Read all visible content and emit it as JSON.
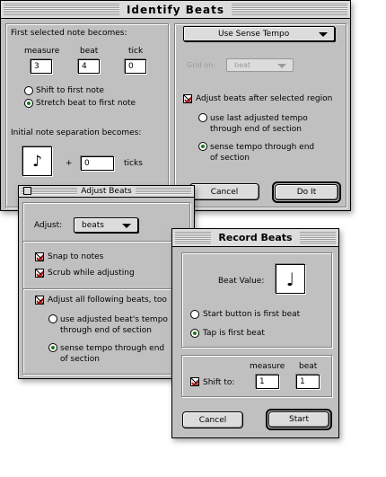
{
  "identify": {
    "title": "Identify Beats",
    "first_note_label": "First selected note becomes:",
    "col_measure": "measure",
    "col_beat": "beat",
    "col_tick": "tick",
    "measure_value": "3",
    "beat_value": "4",
    "tick_value": "0",
    "radio_shift": "Shift to first note",
    "radio_stretch": "Stretch beat to first note",
    "separation_label": "Initial note separation becomes:",
    "note_glyph": "♪",
    "plus": "+",
    "ticks_value": "0",
    "ticks_label": "ticks",
    "mode_popup": "Use Sense Tempo",
    "grid_label": "Grid on:",
    "grid_value": "beat",
    "adjust_after_label": "Adjust beats after selected region",
    "radio_last_adjusted": "use last adjusted tempo through end of section",
    "radio_sense_tempo": "sense tempo through end of section",
    "cancel_label": "Cancel",
    "doit_label": "Do It"
  },
  "adjust": {
    "title": "Adjust Beats",
    "adjust_label": "Adjust:",
    "adjust_value": "beats",
    "snap_label": "Snap to notes",
    "scrub_label": "Scrub while adjusting",
    "all_following_label": "Adjust all following beats, too",
    "radio_adjusted_tempo": "use adjusted beat's tempo through end of section",
    "radio_sense_tempo": "sense tempo through end of section"
  },
  "record": {
    "title": "Record Beats",
    "beat_value_label": "Beat Value:",
    "note_glyph": "♩",
    "radio_start_button": "Start button is first beat",
    "radio_tap": "Tap is first beat",
    "col_measure": "measure",
    "col_beat": "beat",
    "shift_label": "Shift to:",
    "measure_value": "1",
    "beat_value": "1",
    "cancel_label": "Cancel",
    "start_label": "Start"
  },
  "colors": {
    "checkmark": "#c01818",
    "radio_dot": "#1a7a1a",
    "window_bg": "#c0c0c0"
  }
}
